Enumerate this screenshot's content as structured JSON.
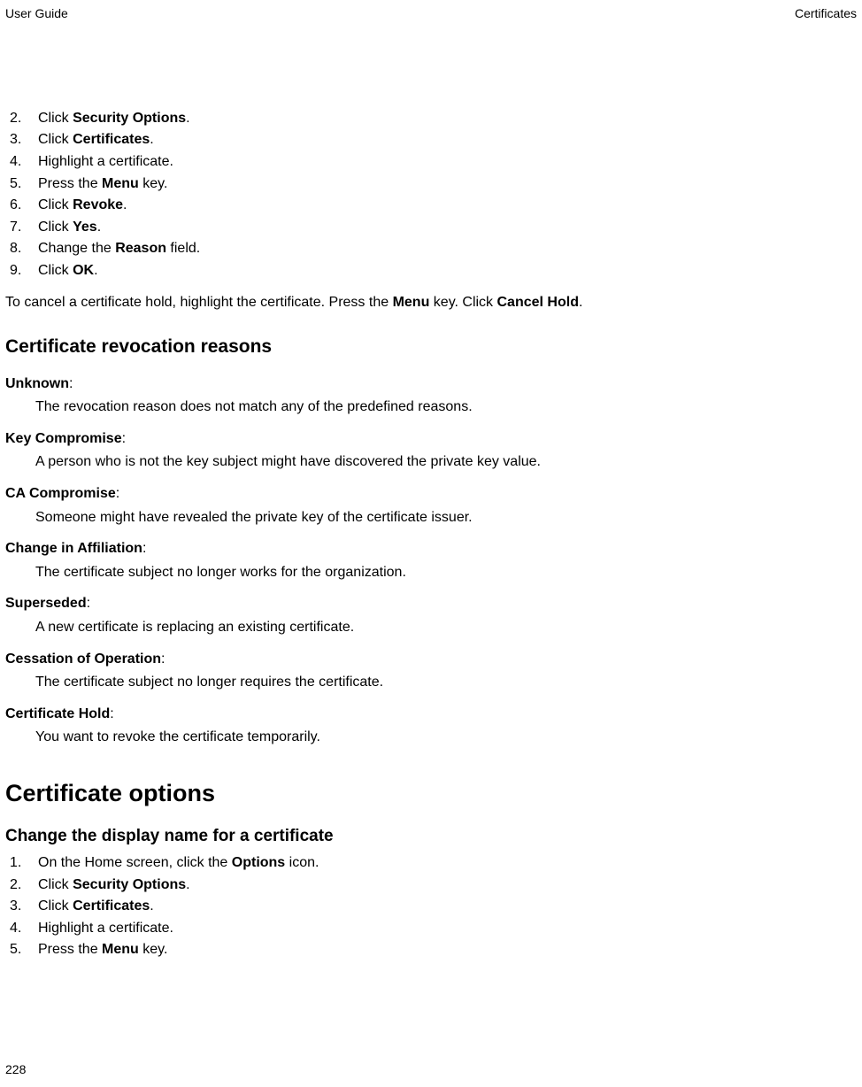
{
  "header": {
    "left": "User Guide",
    "right": "Certificates"
  },
  "intro_steps": [
    {
      "num": "2.",
      "pre": "Click ",
      "bold": "Security Options",
      "post": "."
    },
    {
      "num": "3.",
      "pre": "Click ",
      "bold": "Certificates",
      "post": "."
    },
    {
      "num": "4.",
      "pre": "Highlight a certificate.",
      "bold": "",
      "post": ""
    },
    {
      "num": "5.",
      "pre": "Press the ",
      "bold": "Menu",
      "post": " key."
    },
    {
      "num": "6.",
      "pre": "Click ",
      "bold": "Revoke",
      "post": "."
    },
    {
      "num": "7.",
      "pre": "Click ",
      "bold": "Yes",
      "post": "."
    },
    {
      "num": "8.",
      "pre": "Change the ",
      "bold": "Reason",
      "post": " field."
    },
    {
      "num": "9.",
      "pre": "Click ",
      "bold": "OK",
      "post": "."
    }
  ],
  "cancel_hold": {
    "p1": "To cancel a certificate hold, highlight the certificate. Press the ",
    "b1": "Menu",
    "p2": " key. Click ",
    "b2": "Cancel Hold",
    "p3": "."
  },
  "section_reasons_title": "Certificate revocation reasons",
  "reasons": [
    {
      "term": "Unknown",
      "desc": "The revocation reason does not match any of the predefined reasons."
    },
    {
      "term": "Key Compromise",
      "desc": "A person who is not the key subject might have discovered the private key value."
    },
    {
      "term": "CA Compromise",
      "desc": "Someone might have revealed the private key of the certificate issuer."
    },
    {
      "term": "Change in Affiliation",
      "desc": "The certificate subject no longer works for the organization."
    },
    {
      "term": "Superseded",
      "desc": "A new certificate is replacing an existing certificate."
    },
    {
      "term": "Cessation of Operation",
      "desc": "The certificate subject no longer requires the certificate."
    },
    {
      "term": "Certificate Hold",
      "desc": "You want to revoke the certificate temporarily."
    }
  ],
  "section_options_title": "Certificate options",
  "subsection_display_title": "Change the display name for a certificate",
  "display_steps": [
    {
      "num": "1.",
      "pre": "On the Home screen, click the ",
      "bold": "Options",
      "post": " icon."
    },
    {
      "num": "2.",
      "pre": "Click ",
      "bold": "Security Options",
      "post": "."
    },
    {
      "num": "3.",
      "pre": "Click ",
      "bold": "Certificates",
      "post": "."
    },
    {
      "num": "4.",
      "pre": "Highlight a certificate.",
      "bold": "",
      "post": ""
    },
    {
      "num": "5.",
      "pre": "Press the ",
      "bold": "Menu",
      "post": " key."
    }
  ],
  "page_number": "228"
}
